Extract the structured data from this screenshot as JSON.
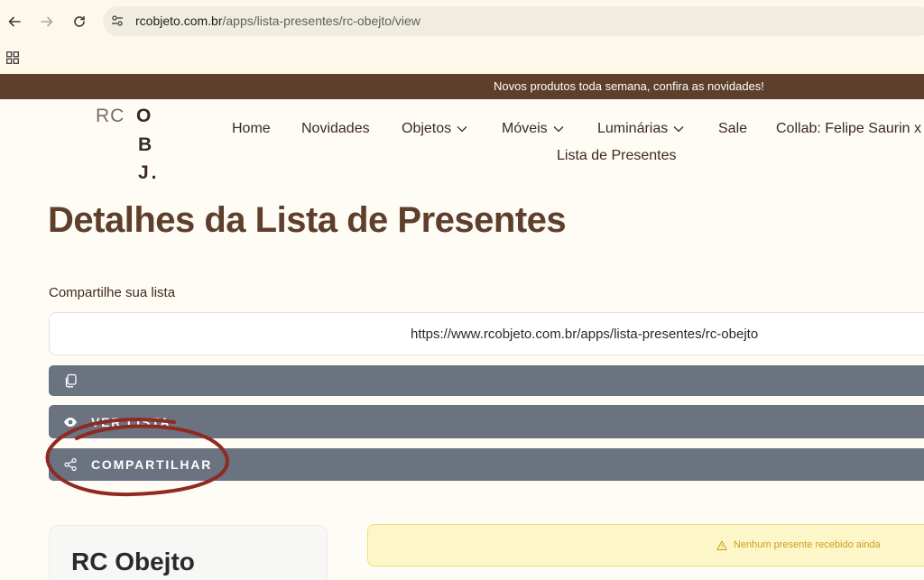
{
  "browser": {
    "url_domain": "rcobjeto.com.br",
    "url_path": "/apps/lista-presentes/rc-obejto/view"
  },
  "announcement": "Novos produtos toda semana, confira as novidades!",
  "logo": {
    "rc": "RC",
    "o": "O",
    "b": "B",
    "j": "J."
  },
  "nav": {
    "home": "Home",
    "novidades": "Novidades",
    "objetos": "Objetos",
    "moveis": "Móveis",
    "luminarias": "Luminárias",
    "sale": "Sale",
    "collab": "Collab: Felipe Saurin x I",
    "lista": "Lista de Presentes"
  },
  "page": {
    "title": "Detalhes da Lista de Presentes",
    "share_label": "Compartilhe sua lista",
    "share_url": "https://www.rcobjeto.com.br/apps/lista-presentes/rc-obejto",
    "view_button": "VER LISTA",
    "share_button": "COMPARTILHAR"
  },
  "card": {
    "title": "RC Obejto"
  },
  "notice": {
    "text": "Nenhum presente recebido ainda"
  },
  "colors": {
    "brand_brown": "#5d3f2c",
    "button_gray": "#6b7280",
    "annotation_red": "#8e2a22",
    "notice_bg": "#fdf6c8"
  }
}
